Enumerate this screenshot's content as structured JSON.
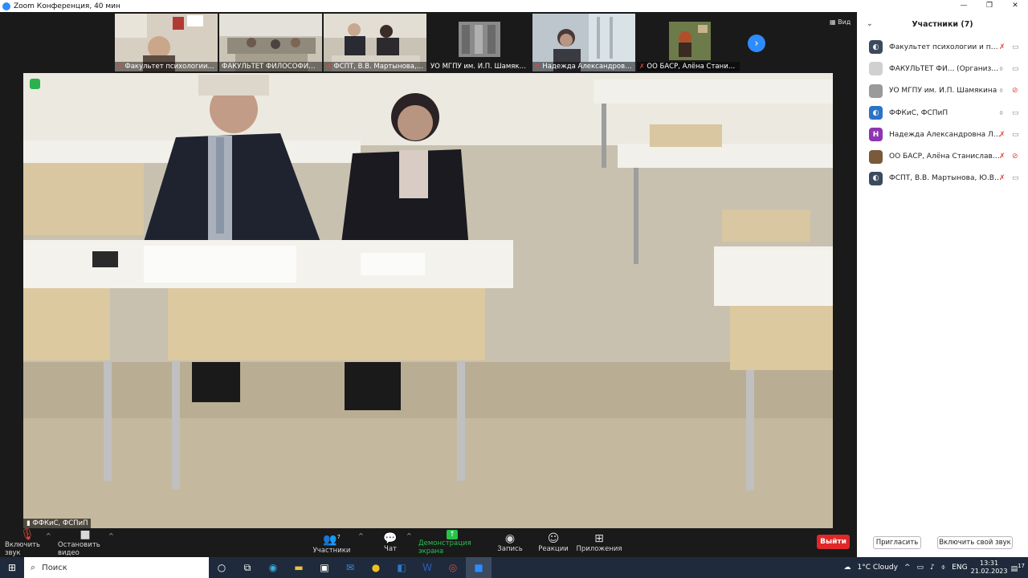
{
  "window": {
    "title": "Zoom Конференция, 40 мин",
    "controls": [
      "minimize",
      "maximize",
      "close"
    ]
  },
  "view_button": "Вид",
  "thumbnails": [
    {
      "name": "Факультет психологии и п...",
      "muted": true
    },
    {
      "name": "ФАКУЛЬТЕТ ФИЛОСОФИИ И ...",
      "muted": false
    },
    {
      "name": "ФСПТ, В.В. Мартынова, Ю....",
      "muted": true
    },
    {
      "name": "УО МГПУ им. И.П. Шамякина",
      "muted": false
    },
    {
      "name": "Надежда Александровна ...",
      "muted": true
    },
    {
      "name": "ОО БАСР, Алёна Станисла...",
      "muted": true
    }
  ],
  "active_speaker": {
    "name": "ФФКиС, ФСПиП"
  },
  "toolbar": {
    "unmute": "Включить звук",
    "stop_video": "Остановить видео",
    "participants": "Участники",
    "participants_count": "7",
    "chat": "Чат",
    "share_screen": "Демонстрация экрана",
    "record": "Запись",
    "reactions": "Реакции",
    "apps": "Приложения",
    "leave": "Выйти"
  },
  "panel": {
    "title": "Участники (7)",
    "participants": [
      {
        "name": "Факультет психологии и пед... (Я)",
        "avatar": "zoom-logo",
        "avatar_color": "#3b4a5e",
        "mic": "muted",
        "cam": "on"
      },
      {
        "name": "ФАКУЛЬТЕТ ФИ...  (Организатор)",
        "avatar": "photo",
        "avatar_color": "#d0d0d0",
        "mic": "on",
        "cam": "on"
      },
      {
        "name": "УО МГПУ им. И.П. Шамякина",
        "avatar": "photo",
        "avatar_color": "#9a9a9a",
        "mic": "on",
        "cam": "off"
      },
      {
        "name": "ФФКиС, ФСПиП",
        "avatar": "zoom-logo",
        "avatar_color": "#2a73c7",
        "mic": "active",
        "cam": "on"
      },
      {
        "name": "Надежда Александровна Леон...",
        "avatar": "Н",
        "avatar_color": "#8e35b0",
        "mic": "muted",
        "cam": "on"
      },
      {
        "name": "ОО БАСР, Алёна Станиславчик",
        "avatar": "photo",
        "avatar_color": "#7a5a3a",
        "mic": "muted",
        "cam": "off"
      },
      {
        "name": "ФСПТ, В.В. Мартынова, Ю.В.Вру...",
        "avatar": "zoom-logo",
        "avatar_color": "#3b4a5e",
        "mic": "muted",
        "cam": "on"
      }
    ],
    "invite": "Пригласить",
    "unmute_self": "Включить свой звук"
  },
  "taskbar": {
    "search_placeholder": "Поиск",
    "weather": "1°C  Cloudy",
    "language": "ENG",
    "time": "13:31",
    "date": "21.02.2023",
    "notifications": "17"
  },
  "colors": {
    "zoom_blue": "#2d8cff",
    "leave_red": "#e02828",
    "share_green": "#27c24c",
    "muted_red": "#e0453a"
  }
}
